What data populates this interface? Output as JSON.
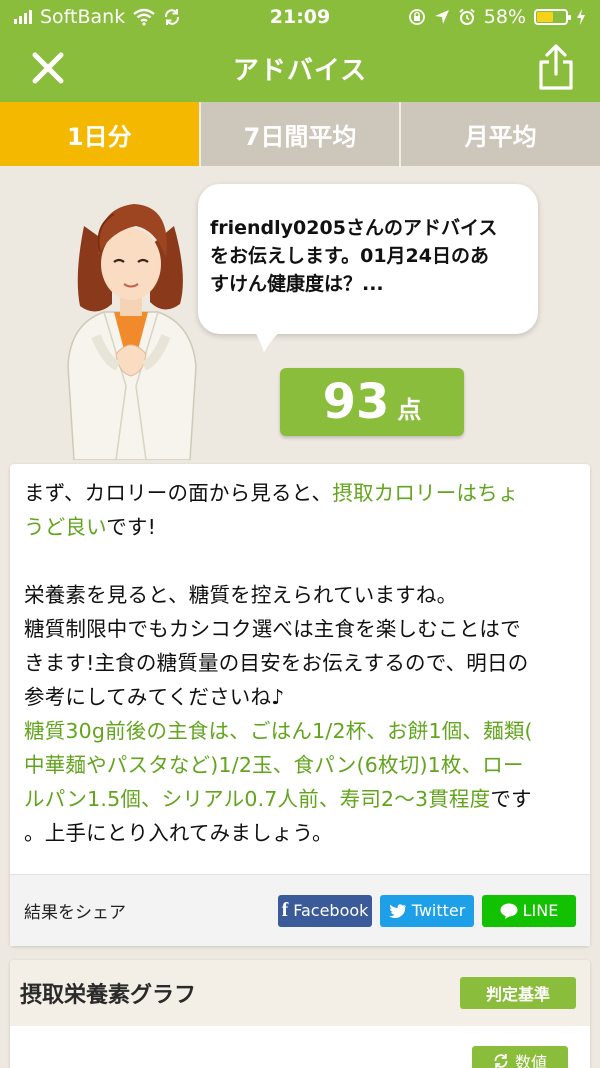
{
  "status_bar": {
    "carrier": "SoftBank",
    "time": "21:09",
    "battery": "58%",
    "battery_level": 0.58
  },
  "nav": {
    "title": "アドバイス"
  },
  "tabs": [
    {
      "label": "1日分",
      "active": true
    },
    {
      "label": "7日間平均",
      "active": false
    },
    {
      "label": "月平均",
      "active": false
    }
  ],
  "advice": {
    "bubble_lines": [
      "friendly0205さんのアドバイス",
      "をお伝えします。01月24日のあ",
      "すけん健康度は？..."
    ],
    "score_value": "93",
    "score_unit": "点"
  },
  "advice_card": {
    "p1_a": "まず、カロリーの面から見ると、",
    "p1_b": "摂取カロリーはちょ",
    "p1_c": "うど良い",
    "p1_d": "です!",
    "p2_l1": "栄養素を見ると、糖質を控えられていますね。",
    "p2_l2": "糖質制限中でもカシコク選べは主食を楽しむことはで",
    "p2_l3": "きます!主食の糖質量の目安をお伝えするので、明日の",
    "p2_l4": "参考にしてみてくださいね♪",
    "p3_l1": "糖質30g前後の主食は、ごはん1/2杯、お餅1個、麺類(",
    "p3_l2": "中華麺やパスタなど)1/2玉、食パン(6枚切)1枚、ロー",
    "p3_l3": "ルパン1.5個、シリアル0.7人前、寿司2〜3貫程度",
    "p3_l3_tail": "です",
    "p3_l4": "。上手にとり入れてみましょう。"
  },
  "share": {
    "label": "結果をシェア",
    "facebook": "Facebook",
    "twitter": "Twitter",
    "line": "LINE"
  },
  "graph": {
    "title": "摂取栄養素グラフ",
    "criteria_button": "判定基準",
    "value_button": "数値"
  },
  "colors": {
    "brand_green": "#8bbd3c",
    "text_green": "#62a51d",
    "tab_active": "#f5b800",
    "tab_inactive": "#cdc6bb",
    "facebook": "#3b5a9a",
    "twitter": "#1ea0e8",
    "line": "#12c100"
  },
  "icons": {
    "close": "close-icon",
    "share": "share-icon",
    "wifi": "wifi-icon",
    "location": "location-icon",
    "alarm": "alarm-icon",
    "refresh": "refresh-icon"
  }
}
